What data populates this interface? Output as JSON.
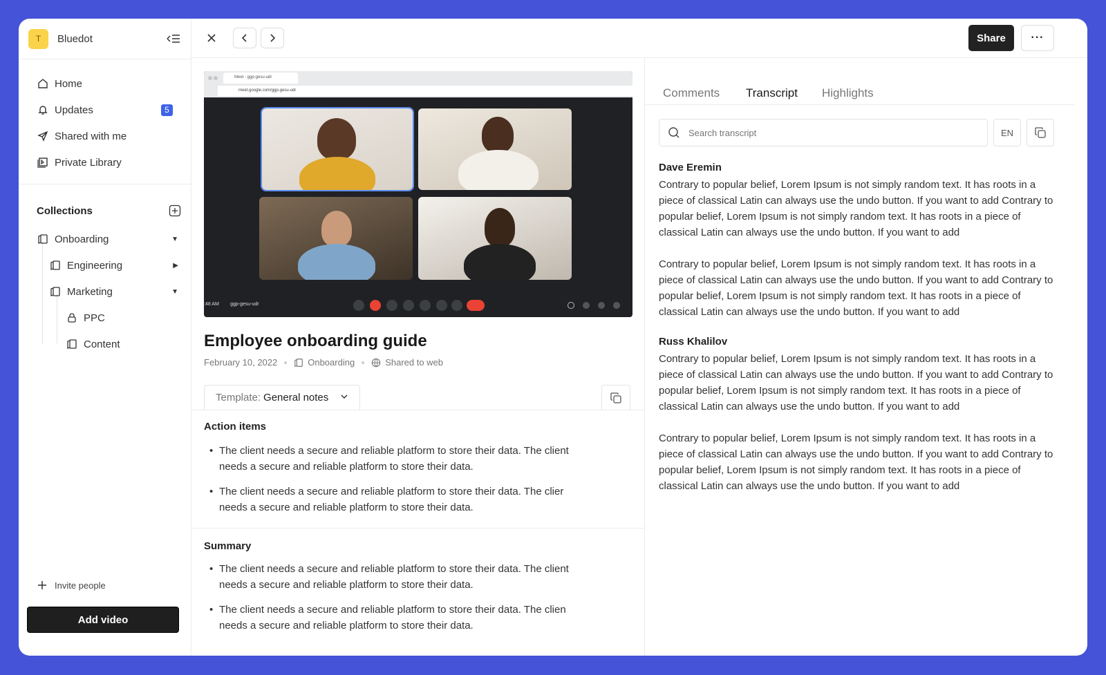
{
  "workspace": {
    "logo_letter": "T",
    "name": "Bluedot"
  },
  "nav": [
    {
      "label": "Home",
      "icon": "home-icon"
    },
    {
      "label": "Updates",
      "icon": "bell-icon",
      "badge": "5"
    },
    {
      "label": "Shared with me",
      "icon": "send-icon"
    },
    {
      "label": "Private Library",
      "icon": "library-icon"
    }
  ],
  "collections": {
    "title": "Collections",
    "items": [
      {
        "label": "Onboarding",
        "level": 0,
        "caret": "▼"
      },
      {
        "label": "Engineering",
        "level": 1,
        "caret": "▶"
      },
      {
        "label": "Marketing",
        "level": 1,
        "caret": "▼"
      },
      {
        "label": "PPC",
        "level": 2,
        "icon": "lock-icon"
      },
      {
        "label": "Content",
        "level": 2
      }
    ]
  },
  "sidebar_footer": {
    "invite": "Invite people",
    "add_video": "Add video"
  },
  "topbar": {
    "share": "Share",
    "more": "···"
  },
  "video": {
    "tab_title": "Meet - ggp-gesu-udr",
    "url": "meet.google.com/ggp-gesu-udr",
    "time": ":48 AM",
    "meeting_code": "ggp-gesu-udr"
  },
  "document": {
    "title": "Employee onboarding guide",
    "date": "February 10, 2022",
    "collection": "Onboarding",
    "visibility": "Shared to web",
    "template_prefix": "Template:",
    "template_value": "General notes"
  },
  "action_items": {
    "title": "Action items",
    "items": [
      "The client needs a secure and reliable platform to store their data. The client needs a secure and reliable platform to store their data.",
      "The client needs a secure and reliable platform to store their data. The clier needs a secure and reliable platform to store their data."
    ]
  },
  "summary": {
    "title": "Summary",
    "items": [
      "The client needs a secure and reliable platform to store their data. The client needs a secure and reliable platform to store their data.",
      "The client needs a secure and reliable platform to store their data. The clien needs a secure and reliable platform to store their data."
    ]
  },
  "right_tabs": [
    "Comments",
    "Transcript",
    "Highlights"
  ],
  "search": {
    "placeholder": "Search transcript"
  },
  "language": "EN",
  "transcript": [
    {
      "speaker": "Dave Eremin",
      "paragraphs": [
        "Contrary to popular belief, Lorem Ipsum is not simply random text. It has roots in a piece of classical Latin can always use the undo button. If you want to add Contrary to popular belief, Lorem Ipsum is not simply random text. It has roots in a piece of classical Latin can always use the undo button. If you want to add",
        "Contrary to popular belief, Lorem Ipsum is not simply random text. It has roots in a piece of classical Latin can always use the undo button. If you want to add Contrary to popular belief, Lorem Ipsum is not simply random text. It has roots in a piece of classical Latin can always use the undo button. If you want to add"
      ]
    },
    {
      "speaker": "Russ Khalilov",
      "paragraphs": [
        "Contrary to popular belief, Lorem Ipsum is not simply random text. It has roots in a piece of classical Latin can always use the undo button. If you want to add Contrary to popular belief, Lorem Ipsum is not simply random text. It has roots in a piece of classical Latin can always use the undo button. If you want to add",
        "Contrary to popular belief, Lorem Ipsum is not simply random text. It has roots in a piece of classical Latin can always use the undo button. If you want to add Contrary to popular belief, Lorem Ipsum is not simply random text. It has roots in a piece of classical Latin can always use the undo button. If you want to add"
      ]
    }
  ],
  "colors": {
    "background": "#4553d8",
    "accent": "#3f63e6",
    "dark_button": "#222222",
    "workspace_logo": "#fbd34a"
  }
}
